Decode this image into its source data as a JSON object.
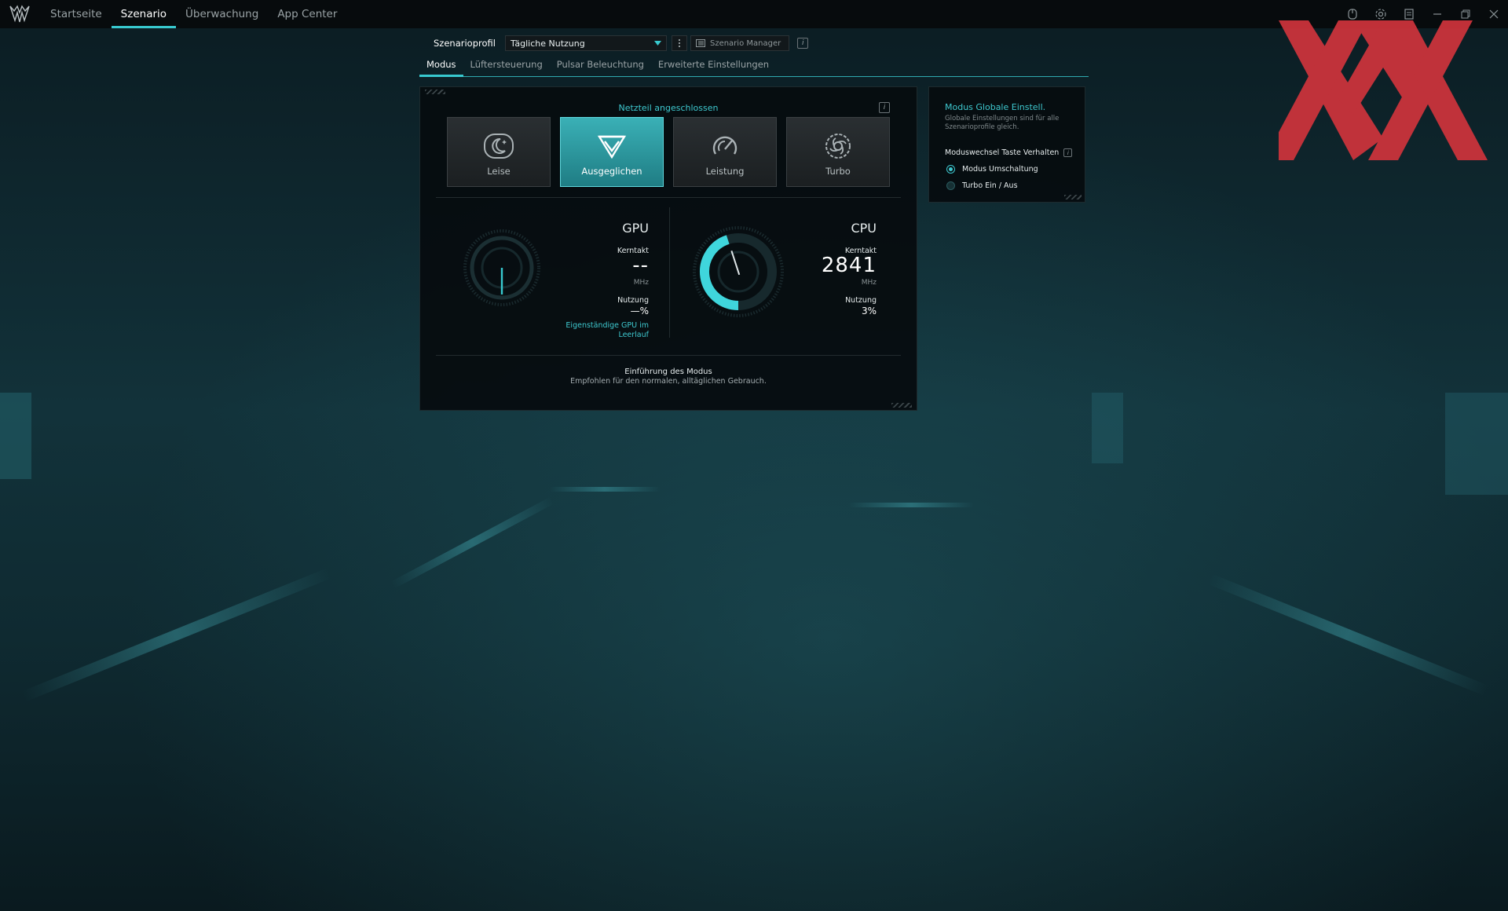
{
  "nav": {
    "items": [
      "Startseite",
      "Szenario",
      "Überwachung",
      "App Center"
    ],
    "active": "Szenario"
  },
  "top_icons": [
    "controller-icon",
    "settings-icon",
    "notes-icon",
    "minimize-icon",
    "restore-icon",
    "close-icon"
  ],
  "profile": {
    "label": "Szenarioprofil",
    "selected": "Tägliche Nutzung",
    "manager_label": "Szenario Manager",
    "info": "i"
  },
  "subtabs": {
    "items": [
      "Modus",
      "Lüftersteuerung",
      "Pulsar Beleuchtung",
      "Erweiterte Einstellungen"
    ],
    "active": "Modus"
  },
  "main": {
    "power_status": "Netzteil angeschlossen",
    "modes": [
      {
        "label": "Leise",
        "icon": "moon-icon",
        "selected": false
      },
      {
        "label": "Ausgeglichen",
        "icon": "balanced-icon",
        "selected": true
      },
      {
        "label": "Leistung",
        "icon": "performance-icon",
        "selected": false
      },
      {
        "label": "Turbo",
        "icon": "turbo-fan-icon",
        "selected": false
      }
    ],
    "gpu": {
      "title": "GPU",
      "clock_label": "Kerntakt",
      "clock_value": "--",
      "clock_unit": "MHz",
      "usage_label": "Nutzung",
      "usage_value": "—%",
      "note": "Eigenständige GPU im Leerlauf",
      "gauge_level": 0
    },
    "cpu": {
      "title": "CPU",
      "clock_label": "Kerntakt",
      "clock_value": "2841",
      "clock_unit": "MHz",
      "usage_label": "Nutzung",
      "usage_value": "3%",
      "gauge_level": 0.45
    },
    "intro_title": "Einführung des Modus",
    "intro_desc": "Empfohlen für den normalen, alltäglichen Gebrauch."
  },
  "global": {
    "title": "Modus Globale Einstell.",
    "desc": "Globale Einstellungen sind für alle Szenarioprofile gleich.",
    "switch_label": "Moduswechsel Taste Verhalten",
    "options": [
      {
        "label": "Modus Umschaltung",
        "selected": true
      },
      {
        "label": "Turbo Ein / Aus",
        "selected": false
      }
    ]
  },
  "colors": {
    "accent": "#38c9cf",
    "watermark": "#d0343c"
  }
}
